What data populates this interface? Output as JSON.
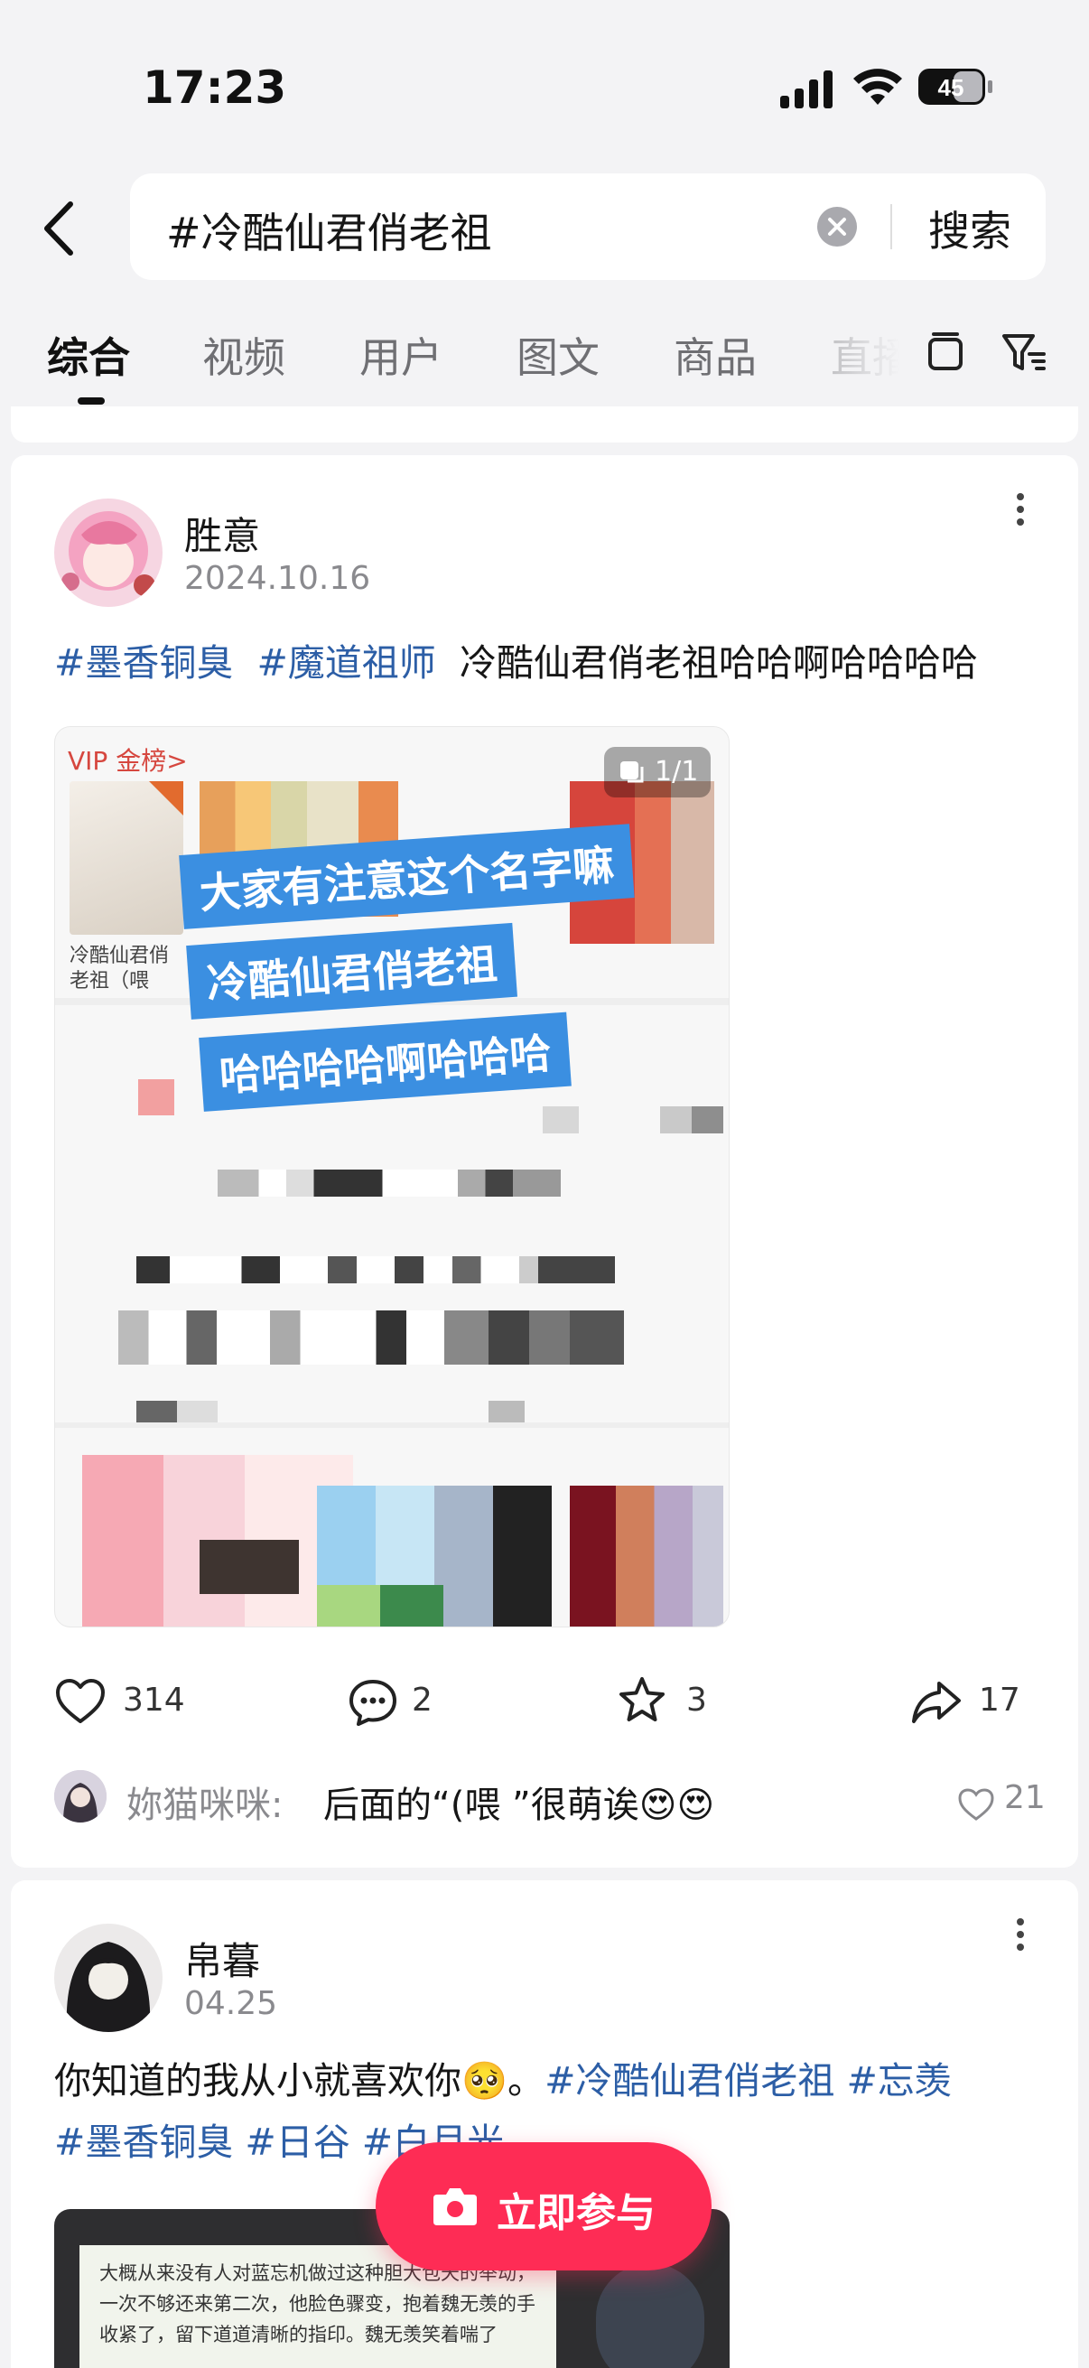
{
  "status_bar": {
    "time": "17:23",
    "battery": "45"
  },
  "search": {
    "query": "#冷酷仙君俏老祖",
    "button_label": "搜索"
  },
  "tabs": [
    {
      "label": "综合",
      "active": true
    },
    {
      "label": "视频"
    },
    {
      "label": "用户"
    },
    {
      "label": "图文"
    },
    {
      "label": "商品"
    },
    {
      "label": "直播"
    }
  ],
  "post1": {
    "author": "胜意",
    "date": "2024.10.16",
    "tag1": "#墨香铜臭",
    "tag2": "#魔道祖师",
    "text": "冷酷仙君俏老祖哈哈啊哈哈哈哈",
    "image": {
      "counter": "1/1",
      "vip_label": "VIP 金榜>",
      "book_title": "冷酷仙君俏老祖（喂",
      "captions": [
        "大家有注意这个名字嘛",
        "冷酷仙君俏老祖",
        "哈哈哈哈啊哈哈哈"
      ]
    },
    "likes": "314",
    "comments": "2",
    "favorites": "3",
    "shares": "17",
    "top_comment": {
      "user": "妳猫咪咪:",
      "text": "后面的“(喂 ”很萌诶😍😍",
      "likes": "21"
    }
  },
  "post2": {
    "author": "帛暮",
    "date": "04.25",
    "text_line1_plain": "你知道的我从小就喜欢你🥺。",
    "text_line1_tags": "#冷酷仙君俏老祖 #忘羡",
    "text_line2_tags": "#墨香铜臭 #日谷 #白月光",
    "image_text": "大概从来没有人对蓝忘机做过这种胆大包天的举动，一次不够还来第二次，他脸色骤变，抱着魏无羡的手收紧了，留下道道清晰的指印。魏无羡笑着喘了"
  },
  "fab": {
    "label": "立即参与"
  },
  "colors": {
    "accent": "#fe2c55",
    "hashtag": "#2c5ea6",
    "caption_bg": "#3b8fe1"
  }
}
